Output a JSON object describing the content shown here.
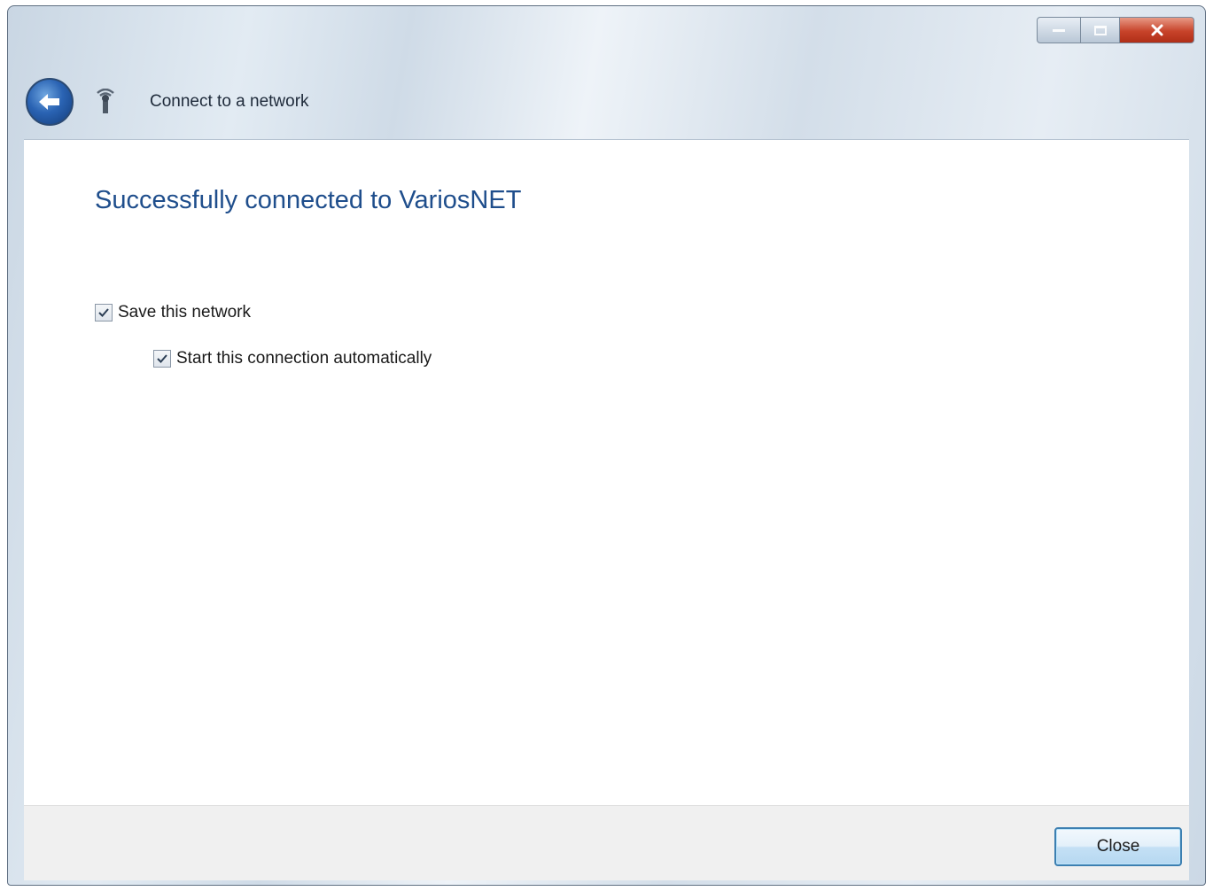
{
  "window": {
    "title": "Connect to a network",
    "controls": {
      "minimize_icon": "minimize-icon",
      "maximize_icon": "maximize-icon",
      "close_icon": "close-icon"
    },
    "accent_color": "#1f4e8c",
    "close_color": "#c7432a"
  },
  "nav": {
    "back_icon": "back-arrow-icon",
    "network_icon": "network-icon"
  },
  "content": {
    "heading": "Successfully connected to VariosNET",
    "options": [
      {
        "label": "Save this network",
        "checked": true
      },
      {
        "label": "Start this connection automatically",
        "checked": true
      }
    ]
  },
  "footer": {
    "close_label": "Close"
  }
}
